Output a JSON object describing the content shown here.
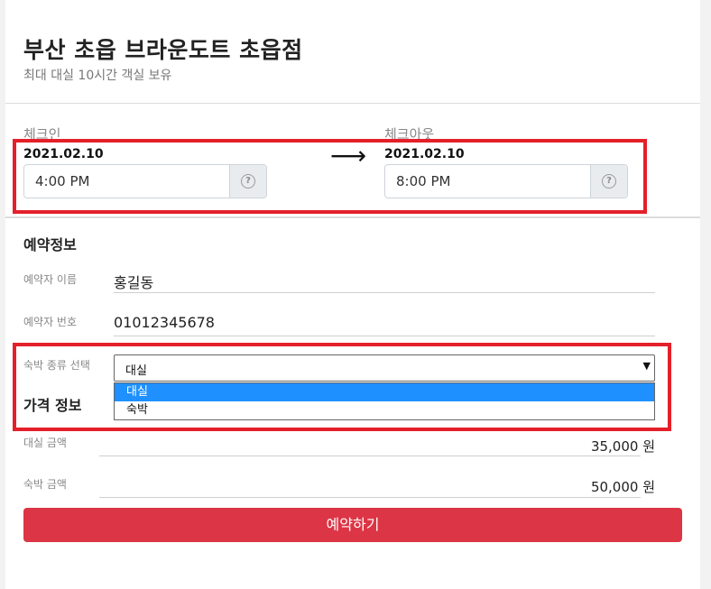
{
  "header": {
    "title": "부산 초읍 브라운도트 초읍점",
    "subtitle": "최대 대실 10시간 객실 보유"
  },
  "checkin": {
    "label": "체크인",
    "date": "2021.02.10",
    "time": "4:00 PM",
    "help_icon": "question-circle-icon"
  },
  "checkout": {
    "label": "체크아웃",
    "date": "2021.02.10",
    "time": "8:00 PM",
    "help_icon": "question-circle-icon"
  },
  "arrow": "⟶",
  "reservation": {
    "title": "예약정보",
    "name_label": "예약자 이름",
    "name_value": "홍길동",
    "phone_label": "예약자 번호",
    "phone_value": "01012345678",
    "type_label": "숙박 종류 선택",
    "type_selected": "대실",
    "type_options": [
      "대실",
      "숙박"
    ]
  },
  "price": {
    "title": "가격 정보",
    "rental_label": "대실 금액",
    "rental_value": "35,000 원",
    "stay_label": "숙박 금액",
    "stay_value": "50,000 원"
  },
  "submit_label": "예약하기",
  "colors": {
    "highlight_border": "#e4202a",
    "button": "#dc3545",
    "selected_option": "#1e90ff"
  }
}
